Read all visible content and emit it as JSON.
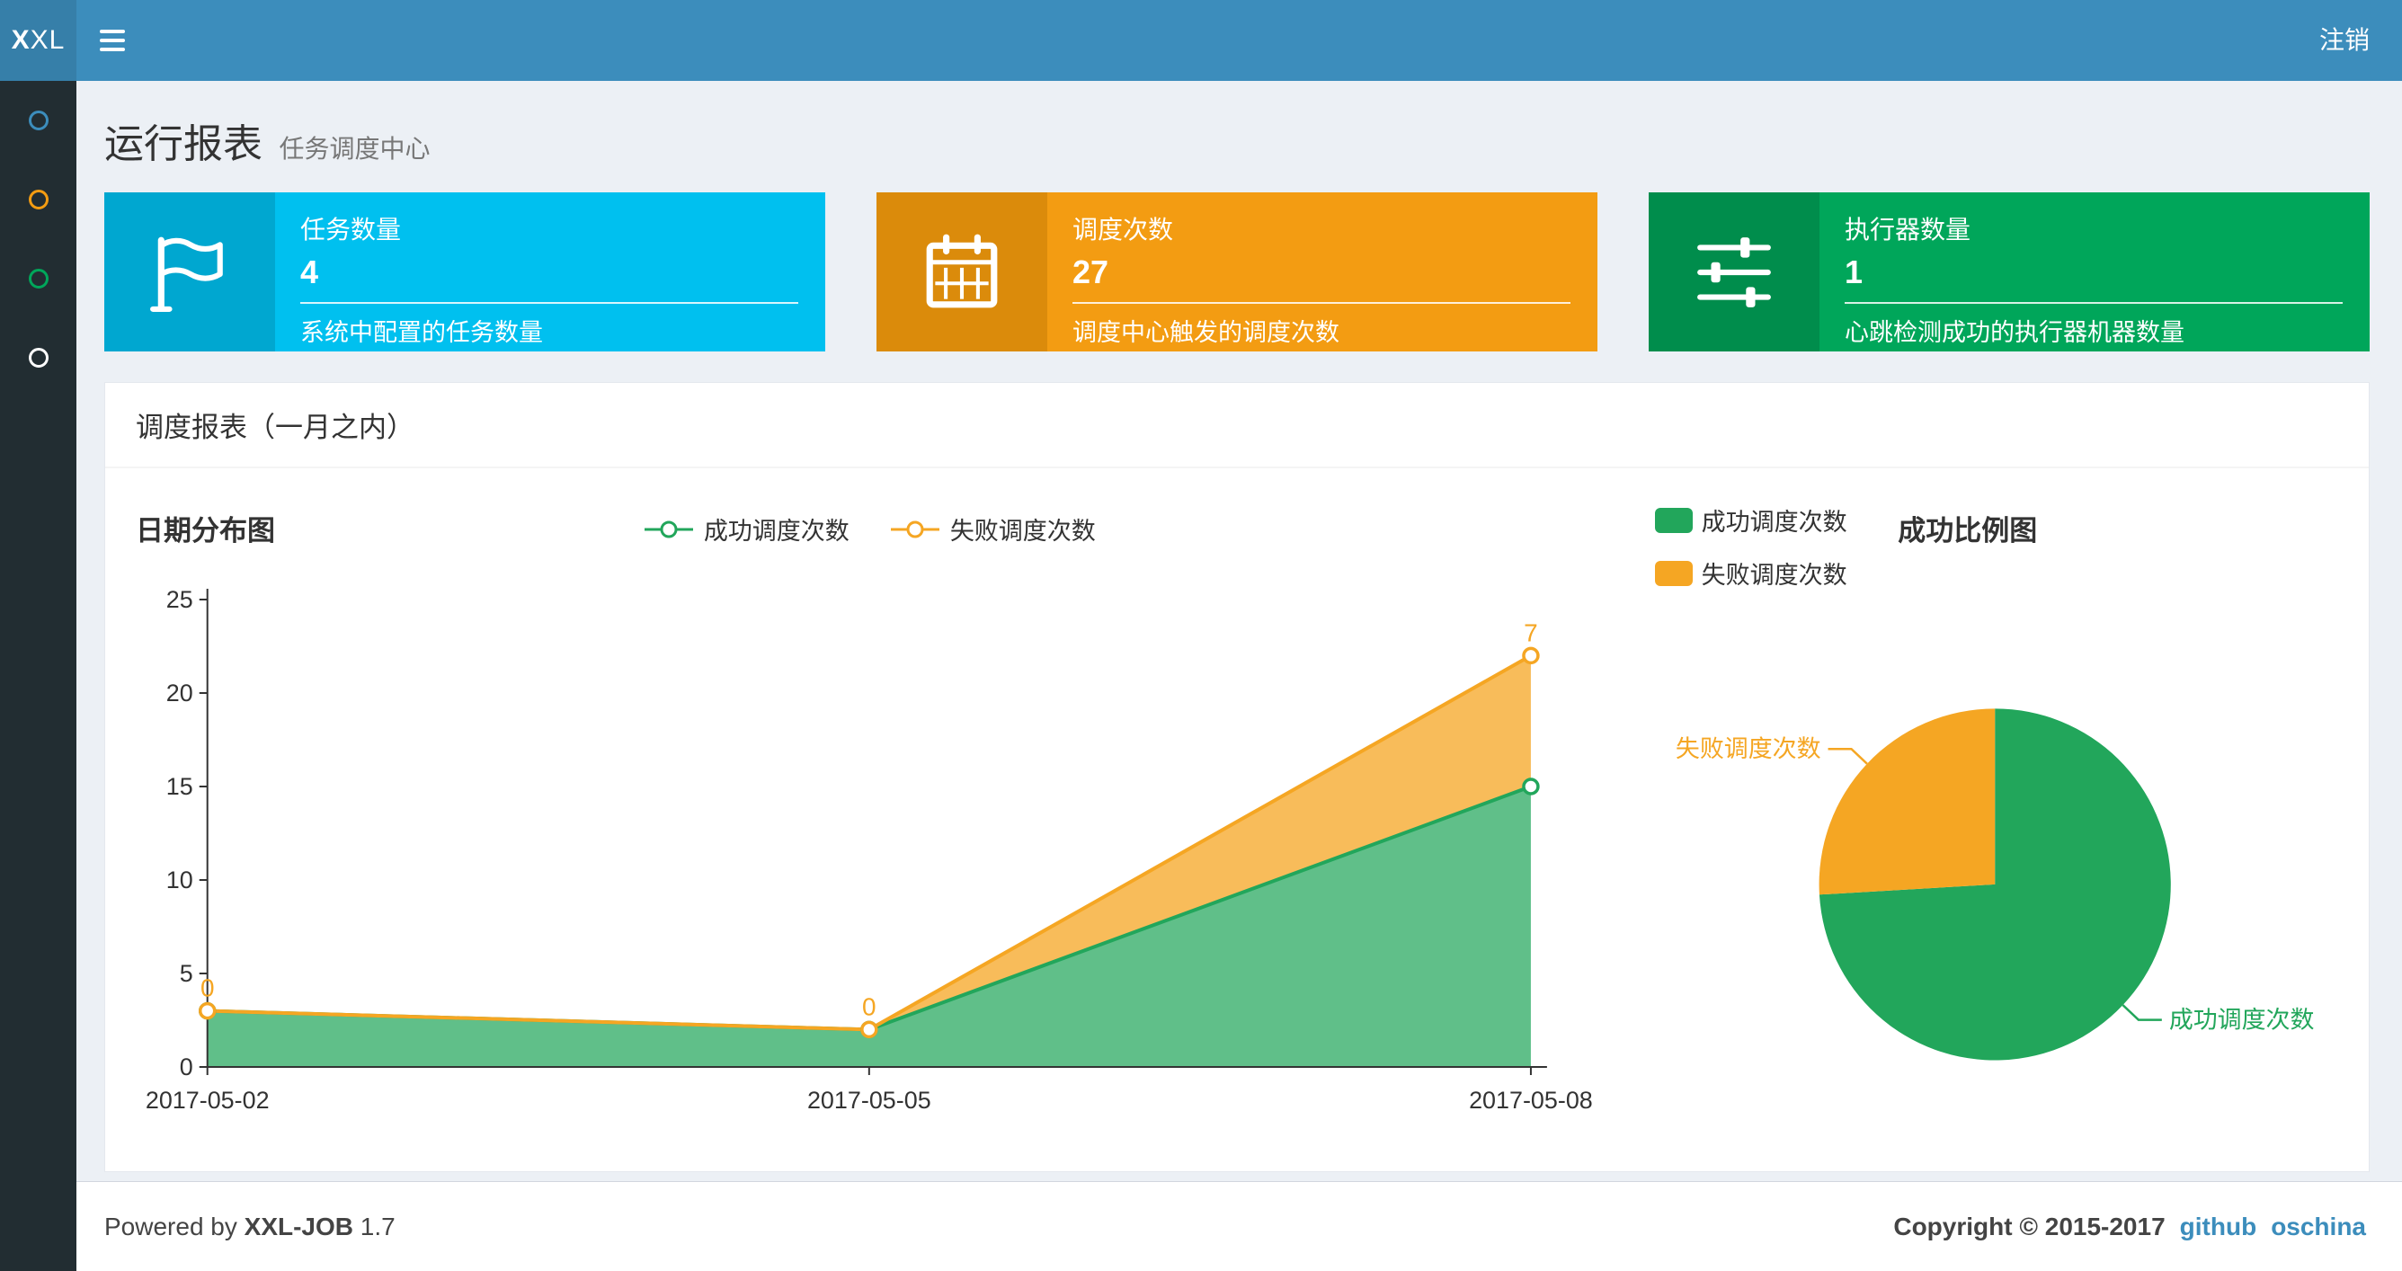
{
  "navbar": {
    "logo_bold": "X",
    "logo_light": "XL",
    "logout": "注销"
  },
  "sidebar": {
    "items": [
      {
        "name": "dashboard",
        "color": "#3c8dbc"
      },
      {
        "name": "job-manage",
        "color": "#f39c12"
      },
      {
        "name": "executor-manage",
        "color": "#00a65a"
      },
      {
        "name": "help",
        "color": "#ffffff"
      }
    ]
  },
  "header": {
    "title": "运行报表",
    "subtitle": "任务调度中心"
  },
  "info_boxes": [
    {
      "icon": "flag-icon",
      "label": "任务数量",
      "value": "4",
      "desc": "系统中配置的任务数量",
      "color": "#00c0ef",
      "icon_color": "#00a7d0"
    },
    {
      "icon": "calendar-icon",
      "label": "调度次数",
      "value": "27",
      "desc": "调度中心触发的调度次数",
      "color": "#f39c12",
      "icon_color": "#db8b0b"
    },
    {
      "icon": "sliders-icon",
      "label": "执行器数量",
      "value": "1",
      "desc": "心跳检测成功的执行器机器数量",
      "color": "#00a65a",
      "icon_color": "#008d4c"
    }
  ],
  "panel": {
    "title": "调度报表（一月之内）"
  },
  "chart_data": [
    {
      "type": "area",
      "title": "日期分布图",
      "stacked": true,
      "x": [
        "2017-05-02",
        "2017-05-05",
        "2017-05-08"
      ],
      "series": [
        {
          "name": "成功调度次数",
          "values": [
            3,
            2,
            15
          ],
          "color": "#22a65b"
        },
        {
          "name": "失败调度次数",
          "values": [
            0,
            0,
            7
          ],
          "color": "#f5a623",
          "labels": [
            "0",
            "0",
            "7"
          ]
        }
      ],
      "ylim": [
        0,
        25
      ],
      "yticks": [
        0,
        5,
        10,
        15,
        20,
        25
      ],
      "legend_position": "top-center",
      "grid": false
    },
    {
      "type": "pie",
      "title": "成功比例图",
      "slices": [
        {
          "name": "成功调度次数",
          "value": 20,
          "color": "#22a65b"
        },
        {
          "name": "失败调度次数",
          "value": 7,
          "color": "#f5a623"
        }
      ],
      "legend_position": "top-left"
    }
  ],
  "footer": {
    "powered_prefix": "Powered by",
    "product": "XXL-JOB",
    "version": "1.7",
    "copyright": "Copyright © 2015-2017",
    "links": [
      {
        "label": "github"
      },
      {
        "label": "oschina"
      }
    ]
  }
}
